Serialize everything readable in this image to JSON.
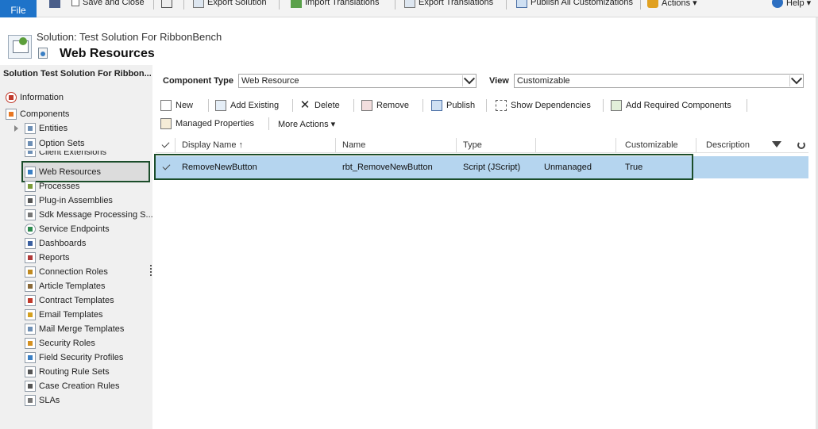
{
  "ribbon": {
    "file_label": "File",
    "buttons": [
      {
        "label": "Save and Close",
        "icon": "save-close-icon"
      },
      {
        "label": "",
        "icon": "print-icon"
      },
      {
        "label": "Export Solution",
        "icon": "export-solution-icon"
      },
      {
        "label": "Import Translations",
        "icon": "import-translations-icon"
      },
      {
        "label": "Export Translations",
        "icon": "export-translations-icon"
      },
      {
        "label": "Publish All Customizations",
        "icon": "publish-all-icon"
      },
      {
        "label": "Actions ▾",
        "icon": "actions-icon"
      },
      {
        "label": "Help ▾",
        "icon": "help-icon"
      }
    ]
  },
  "header": {
    "solution_label": "Solution: Test Solution For RibbonBench",
    "page_title": "Web Resources"
  },
  "leftnav": {
    "heading": "Solution Test Solution For Ribbon...",
    "items": [
      {
        "label": "Information",
        "icon": "information-icon"
      },
      {
        "label": "Components",
        "icon": "components-icon"
      },
      {
        "label": "Entities",
        "icon": "entities-icon"
      },
      {
        "label": "Option Sets",
        "icon": "option-sets-icon"
      },
      {
        "label": "Client Extensions",
        "icon": "client-extensions-icon"
      },
      {
        "label": "Web Resources",
        "icon": "web-resources-icon"
      },
      {
        "label": "Processes",
        "icon": "processes-icon"
      },
      {
        "label": "Plug-in Assemblies",
        "icon": "plugin-assemblies-icon"
      },
      {
        "label": "Sdk Message Processing S...",
        "icon": "sdk-message-icon"
      },
      {
        "label": "Service Endpoints",
        "icon": "service-endpoints-icon"
      },
      {
        "label": "Dashboards",
        "icon": "dashboards-icon"
      },
      {
        "label": "Reports",
        "icon": "reports-icon"
      },
      {
        "label": "Connection Roles",
        "icon": "connection-roles-icon"
      },
      {
        "label": "Article Templates",
        "icon": "article-templates-icon"
      },
      {
        "label": "Contract Templates",
        "icon": "contract-templates-icon"
      },
      {
        "label": "Email Templates",
        "icon": "email-templates-icon"
      },
      {
        "label": "Mail Merge Templates",
        "icon": "mail-merge-icon"
      },
      {
        "label": "Security Roles",
        "icon": "security-roles-icon"
      },
      {
        "label": "Field Security Profiles",
        "icon": "field-security-icon"
      },
      {
        "label": "Routing Rule Sets",
        "icon": "routing-rules-icon"
      },
      {
        "label": "Case Creation Rules",
        "icon": "case-creation-icon"
      },
      {
        "label": "SLAs",
        "icon": "slas-icon"
      }
    ]
  },
  "filters": {
    "component_type_label": "Component Type",
    "component_type_value": "Web Resource",
    "view_label": "View",
    "view_value": "Customizable"
  },
  "toolbar": {
    "row1": [
      {
        "label": "New",
        "icon": "new-icon"
      },
      {
        "label": "Add Existing",
        "icon": "add-existing-icon"
      },
      {
        "label": "Delete",
        "icon": "delete-icon"
      },
      {
        "label": "Remove",
        "icon": "remove-icon"
      },
      {
        "label": "Publish",
        "icon": "publish-icon"
      },
      {
        "label": "Show Dependencies",
        "icon": "dependencies-icon"
      },
      {
        "label": "Add Required Components",
        "icon": "required-components-icon"
      }
    ],
    "row2": [
      {
        "label": "Managed Properties",
        "icon": "managed-properties-icon"
      },
      {
        "label": "More Actions ▾",
        "icon": ""
      }
    ]
  },
  "grid": {
    "columns": [
      "Display Name ↑",
      "Name",
      "Type",
      "",
      "Customizable",
      "Description"
    ],
    "rows": [
      {
        "display_name": "RemoveNewButton",
        "name": "rbt_RemoveNewButton",
        "type": "Script (JScript)",
        "state": "Unmanaged",
        "customizable": "True",
        "description": ""
      }
    ]
  },
  "colors": {
    "file_blue": "#1e73c9",
    "selection_blue": "#b5d5ef",
    "highlight_green": "#1b4d2a",
    "nav_bg": "#f0f0f0"
  }
}
